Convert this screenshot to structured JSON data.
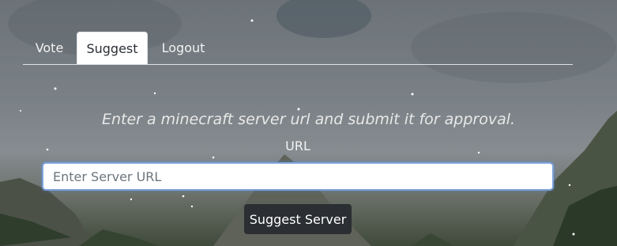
{
  "nav": {
    "tabs": [
      {
        "label": "Vote",
        "active": false
      },
      {
        "label": "Suggest",
        "active": true
      },
      {
        "label": "Logout",
        "active": false
      }
    ]
  },
  "suggest_form": {
    "instructions": "Enter a minecraft server url and submit it for approval.",
    "url_label": "URL",
    "url_placeholder": "Enter Server URL",
    "url_value": "",
    "submit_label": "Suggest Server"
  },
  "colors": {
    "active_tab_bg": "#ffffff",
    "button_bg": "#2b2e32",
    "input_focus_border": "#7da3da"
  }
}
